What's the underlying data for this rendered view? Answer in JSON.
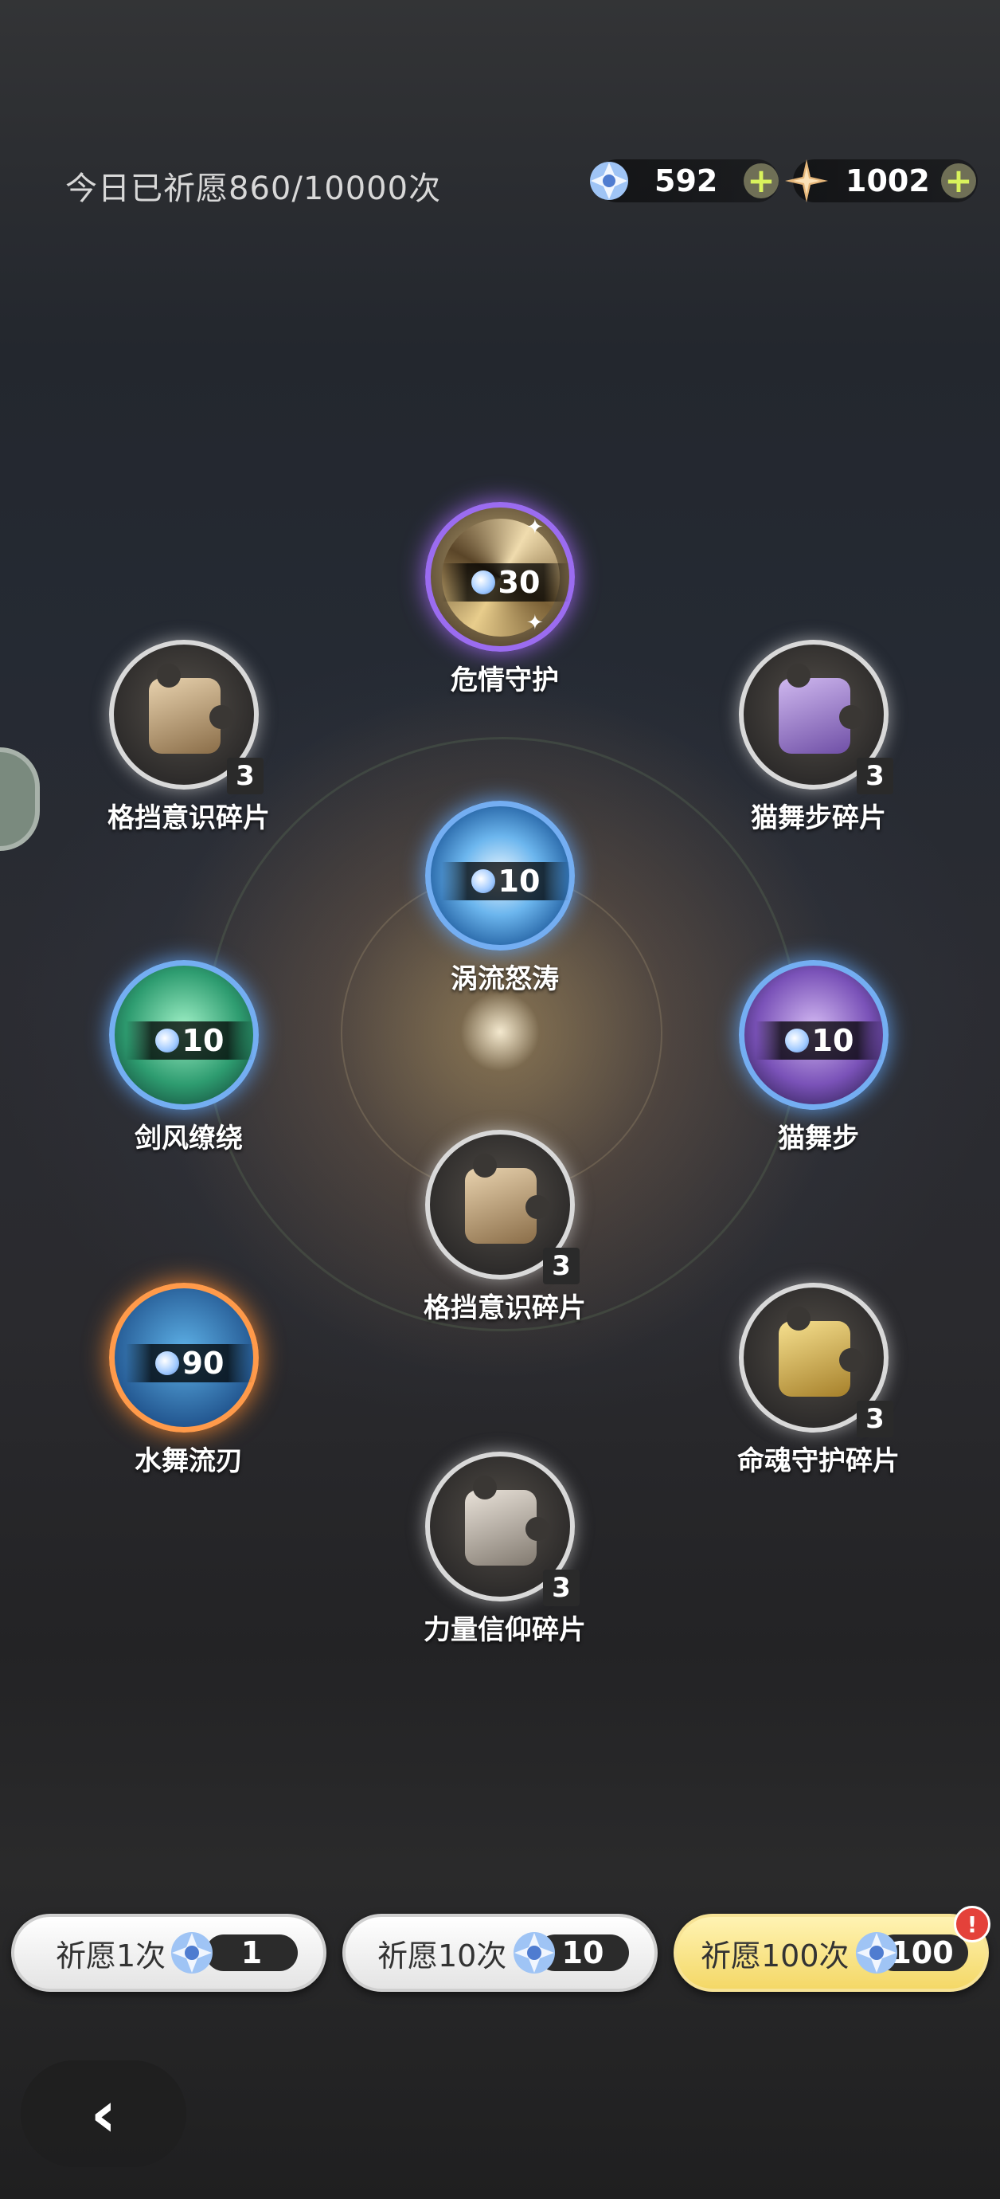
{
  "header": {
    "today_count": "今日已祈愿860/10000次"
  },
  "currencies": [
    {
      "name": "wish-crystal",
      "value": "592"
    },
    {
      "name": "star-shard",
      "value": "1002"
    }
  ],
  "nodes": {
    "duo_qing": {
      "label": "危情守护",
      "cost": "30"
    },
    "ge_dang_top": {
      "label": "格挡意识碎片",
      "count": "3"
    },
    "mao_wu_bu_sui": {
      "label": "猫舞步碎片",
      "count": "3"
    },
    "wo_liu": {
      "label": "涡流怒涛",
      "cost": "10"
    },
    "jian_feng": {
      "label": "剑风缭绕",
      "cost": "10"
    },
    "mao_wu_bu": {
      "label": "猫舞步",
      "cost": "10"
    },
    "ge_dang_mid": {
      "label": "格挡意识碎片",
      "count": "3"
    },
    "shui_wu": {
      "label": "水舞流刃",
      "cost": "90"
    },
    "ming_hun": {
      "label": "命魂守护碎片",
      "count": "3"
    },
    "li_liang": {
      "label": "力量信仰碎片",
      "count": "3"
    }
  },
  "buttons": {
    "pray1": {
      "label": "祈愿1次",
      "cost": "1"
    },
    "pray10": {
      "label": "祈愿10次",
      "cost": "10"
    },
    "pray100": {
      "label": "祈愿100次",
      "cost": "100"
    },
    "alert": "!",
    "back": "‹"
  }
}
